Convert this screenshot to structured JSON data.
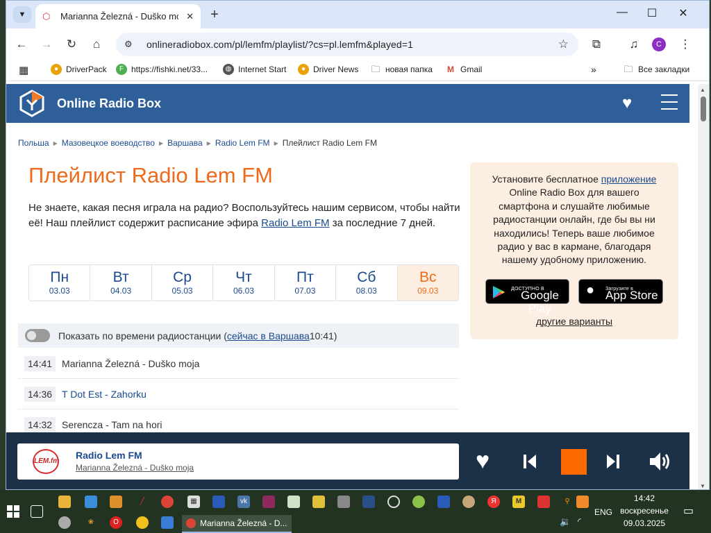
{
  "browser": {
    "tab_title": "Marianna Železná - Duško moja",
    "url": "onlineradiobox.com/pl/lemfm/playlist/?cs=pl.lemfm&played=1",
    "profile_letter": "C",
    "bookmarks": [
      {
        "label": "DriverPack",
        "icon": "driverpack-icon",
        "color": "#e9a20a"
      },
      {
        "label": "https://fishki.net/33...",
        "icon": "fishki-icon",
        "color": "#4caf50"
      },
      {
        "label": "Internet Start",
        "icon": "globe-icon",
        "color": "#555555"
      },
      {
        "label": "Driver News",
        "icon": "driverpack-icon",
        "color": "#e9a20a"
      },
      {
        "label": "новая папка",
        "icon": "folder-icon",
        "color": "#333333"
      },
      {
        "label": "Gmail",
        "icon": "gmail-icon",
        "color": "#d44638"
      }
    ],
    "all_bookmarks": "Все закладки"
  },
  "site": {
    "name": "Online Radio Box",
    "brand_color": "#2e5f98",
    "accent_color": "#ee6a1c"
  },
  "breadcrumb": [
    "Польша",
    "Мазовецкое воеводство",
    "Варшава",
    "Radio Lem FM",
    "Плейлист Radio Lem FM"
  ],
  "page": {
    "title": "Плейлист Radio Lem FM",
    "intro_before": "Не знаете, какая песня играла на радио? Воспользуйтесь нашим сервисом, чтобы найти её! Наш плейлист содержит расписание эфира ",
    "intro_link": "Radio Lem FM",
    "intro_after": " за последние 7 дней."
  },
  "days": [
    {
      "name": "Пн",
      "date": "03.03"
    },
    {
      "name": "Вт",
      "date": "04.03"
    },
    {
      "name": "Ср",
      "date": "05.03"
    },
    {
      "name": "Чт",
      "date": "06.03"
    },
    {
      "name": "Пт",
      "date": "07.03"
    },
    {
      "name": "Сб",
      "date": "08.03"
    },
    {
      "name": "Вс",
      "date": "09.03",
      "active": true
    }
  ],
  "timebar": {
    "label": "Показать по времени радиостанции (",
    "link": "сейчас в Варшава",
    "time": " 10:41)"
  },
  "tracks": [
    {
      "time": "14:41",
      "title": "Marianna Železná - Duško moja",
      "linked": false
    },
    {
      "time": "14:36",
      "title": "T Dot Est - Zahorku",
      "linked": true
    },
    {
      "time": "14:32",
      "title": "Serencza - Tam na hori",
      "linked": false
    }
  ],
  "promo": {
    "line1": "Установите бесплатное ",
    "link": "приложение",
    "rest": " Online Radio Box для вашего смартфона и слушайте любимые радиостанции онлайн, где бы вы ни находились! Теперь ваше любимое радио у вас в кармане, благодаря нашему удобному приложению.",
    "google_small": "ДОСТУПНО В",
    "google_big": "Google Play",
    "apple_small": "Загрузите в",
    "apple_big": "App Store",
    "other": "другие варианты"
  },
  "player": {
    "logo_text": "LEM.fm",
    "station": "Radio Lem FM",
    "song": "Marianna Železná - Duško moja",
    "stop_color": "#ff6a00"
  },
  "taskbar": {
    "active_task": "Marianna Železná - D...",
    "lang": "ENG",
    "time": "14:42",
    "weekday": "воскресенье",
    "date": "09.03.2025"
  }
}
